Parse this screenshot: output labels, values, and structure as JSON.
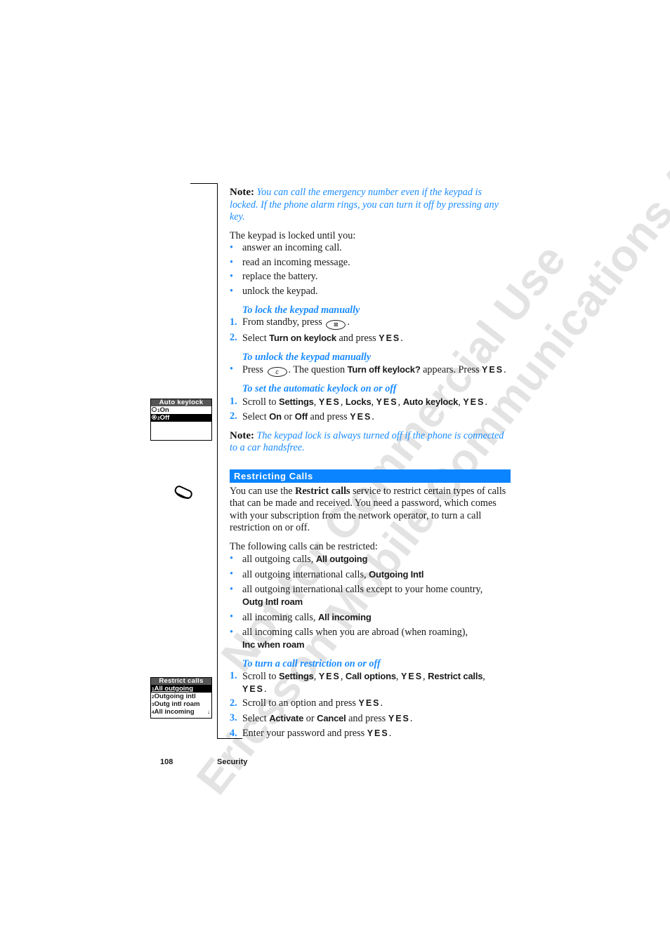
{
  "watermark": {
    "line1": "Not for Commercial Use",
    "line2": "Ericsson Mobile Communications AB"
  },
  "note1": {
    "label": "Note:",
    "text": "You can call the emergency number even if the keypad is locked. If the phone alarm rings, you can turn it off by pressing any key."
  },
  "locked_until": {
    "intro": "The keypad is locked until you:",
    "items": [
      "answer an incoming call.",
      "read an incoming message.",
      "replace the battery.",
      "unlock the keypad."
    ]
  },
  "lock_manual": {
    "heading": "To lock the keypad manually",
    "step1_num": "1.",
    "step1_pre": "From standby, press",
    "step1_key_icon": "keylock-key-icon",
    "step1_post": ".",
    "step2_num": "2.",
    "step2_pre": "Select",
    "step2_ui": "Turn on keylock",
    "step2_mid": "and press",
    "step2_yes": "YES",
    "step2_post": "."
  },
  "unlock_manual": {
    "heading": "To unlock the keypad manually",
    "pre": "Press",
    "key_label": "c",
    "mid": ". The question",
    "ui": "Turn off keylock?",
    "mid2": "appears. Press",
    "yes": "YES",
    "post": "."
  },
  "auto_keylock": {
    "heading": "To set the automatic keylock on or off",
    "step1_num": "1.",
    "step1_pre": "Scroll to",
    "step1_ui1": "Settings",
    "step1_yes1": "YES",
    "step1_ui2": "Locks",
    "step1_yes2": "YES",
    "step1_ui3": "Auto keylock",
    "step1_yes3": "YES",
    "sep": ",",
    "step1_post": ".",
    "step2_num": "2.",
    "step2_pre": "Select",
    "step2_ui1": "On",
    "step2_or": "or",
    "step2_ui2": "Off",
    "step2_mid": "and press",
    "step2_yes": "YES",
    "step2_post": "."
  },
  "note2": {
    "label": "Note:",
    "text": "The keypad lock is always turned off if the phone is connected to a car handsfree."
  },
  "screen_auto_keylock": {
    "title": "Auto keylock",
    "rows": [
      {
        "index": "1",
        "label": "On",
        "selected": false,
        "radio_on": false
      },
      {
        "index": "2",
        "label": "Off",
        "selected": true,
        "radio_on": true
      }
    ]
  },
  "section": {
    "title": "Restricting Calls"
  },
  "restrict_intro": {
    "pre": "You can use the",
    "bold": "Restrict calls",
    "post": "service to restrict certain types of calls that can be made and received. You need a password, which comes with your subscription from the network operator, to turn a call restriction on or off."
  },
  "restrict_list": {
    "intro": "The following calls can be restricted:",
    "items": [
      {
        "text": "all outgoing calls,",
        "ui": "All outgoing",
        "wrap": false
      },
      {
        "text": "all outgoing international calls,",
        "ui": "Outgoing Intl",
        "wrap": false
      },
      {
        "text": "all outgoing international calls except to your home country,",
        "ui": "Outg Intl roam",
        "wrap": true
      },
      {
        "text": "all incoming calls,",
        "ui": "All incoming",
        "wrap": false
      },
      {
        "text": "all incoming calls when you are abroad (when roaming),",
        "ui": "Inc when roam",
        "wrap": true
      }
    ]
  },
  "restrict_steps": {
    "heading": "To turn a call restriction on or off",
    "s1_num": "1.",
    "s1_pre": "Scroll to",
    "s1_ui1": "Settings",
    "s1_yes1": "YES",
    "s1_ui2": "Call options",
    "s1_yes2": "YES",
    "s1_ui3": "Restrict calls",
    "s1_yes3": "YES",
    "sep": ",",
    "period": ".",
    "s2_num": "2.",
    "s2_text": "Scroll to an option and press",
    "s2_yes": "YES",
    "s3_num": "3.",
    "s3_pre": "Select",
    "s3_ui1": "Activate",
    "s3_or": "or",
    "s3_ui2": "Cancel",
    "s3_mid": "and press",
    "s3_yes": "YES",
    "s4_num": "4.",
    "s4_text": "Enter your password and press",
    "s4_yes": "YES"
  },
  "screen_restrict_calls": {
    "title": "Restrict calls",
    "rows": [
      {
        "index": "1",
        "label": "All outgoing",
        "selected": true
      },
      {
        "index": "2",
        "label": "Outgoing intl",
        "selected": false
      },
      {
        "index": "3",
        "label": "Outg intl roam",
        "selected": false
      },
      {
        "index": "4",
        "label": "All incoming",
        "selected": false
      }
    ],
    "scroll_indicator": "↓"
  },
  "footer": {
    "page_number": "108",
    "chapter": "Security"
  },
  "colors": {
    "accent_blue": "#1a8cff",
    "section_bar": "#0a84ff"
  }
}
